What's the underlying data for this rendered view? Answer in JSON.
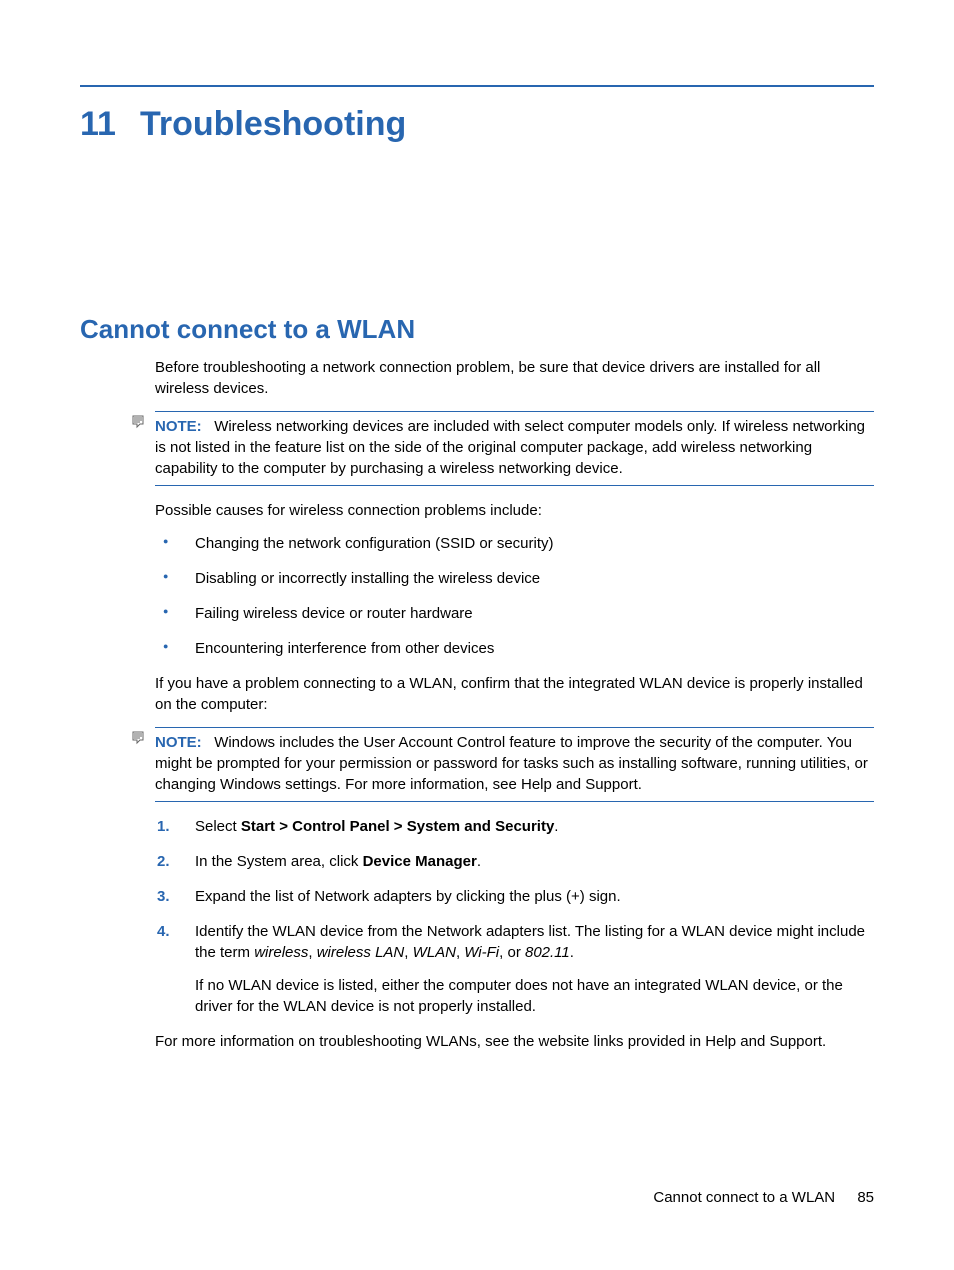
{
  "chapter": {
    "number": "11",
    "title": "Troubleshooting"
  },
  "section": {
    "title": "Cannot connect to a WLAN"
  },
  "intro": "Before troubleshooting a network connection problem, be sure that device drivers are installed for all wireless devices.",
  "note1": {
    "label": "NOTE:",
    "text": "Wireless networking devices are included with select computer models only. If wireless networking is not listed in the feature list on the side of the original computer package, add wireless networking capability to the computer by purchasing a wireless networking device."
  },
  "causes_intro": "Possible causes for wireless connection problems include:",
  "causes": [
    "Changing the network configuration (SSID or security)",
    "Disabling or incorrectly installing the wireless device",
    "Failing wireless device or router hardware",
    "Encountering interference from other devices"
  ],
  "confirm_text": "If you have a problem connecting to a WLAN, confirm that the integrated WLAN device is properly installed on the computer:",
  "note2": {
    "label": "NOTE:",
    "text": "Windows includes the User Account Control feature to improve the security of the computer. You might be prompted for your permission or password for tasks such as installing software, running utilities, or changing Windows settings. For more information, see Help and Support."
  },
  "steps": {
    "s1_a": "Select ",
    "s1_b": "Start > Control Panel > System and Security",
    "s1_c": ".",
    "s2_a": "In the System area, click ",
    "s2_b": "Device Manager",
    "s2_c": ".",
    "s3": "Expand the list of Network adapters by clicking the plus (+) sign.",
    "s4_a": "Identify the WLAN device from the Network adapters list. The listing for a WLAN device might include the term ",
    "s4_i1": "wireless",
    "s4_c1": ", ",
    "s4_i2": "wireless LAN",
    "s4_c2": ", ",
    "s4_i3": "WLAN",
    "s4_c3": ", ",
    "s4_i4": "Wi-Fi",
    "s4_c4": ", or ",
    "s4_i5": "802.11",
    "s4_c5": ".",
    "s4_sub": "If no WLAN device is listed, either the computer does not have an integrated WLAN device, or the driver for the WLAN device is not properly installed."
  },
  "closing": "For more information on troubleshooting WLANs, see the website links provided in Help and Support.",
  "footer": {
    "text": "Cannot connect to a WLAN",
    "page": "85"
  },
  "nums": {
    "n1": "1.",
    "n2": "2.",
    "n3": "3.",
    "n4": "4."
  }
}
